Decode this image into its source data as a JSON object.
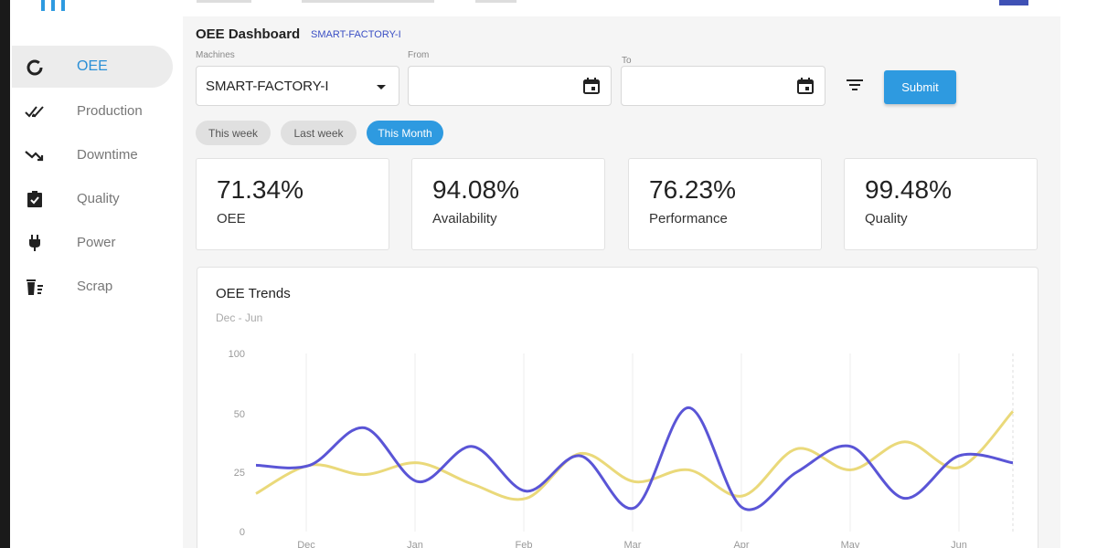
{
  "sidebar": {
    "items": [
      {
        "label": "OEE",
        "icon": "donut-chart-icon",
        "active": true
      },
      {
        "label": "Production",
        "icon": "double-check-icon",
        "active": false
      },
      {
        "label": "Downtime",
        "icon": "trending-down-icon",
        "active": false
      },
      {
        "label": "Quality",
        "icon": "clipboard-check-icon",
        "active": false
      },
      {
        "label": "Power",
        "icon": "plug-icon",
        "active": false
      },
      {
        "label": "Scrap",
        "icon": "trash-list-icon",
        "active": false
      }
    ]
  },
  "header": {
    "title": "OEE Dashboard",
    "machine_tag": "SMART-FACTORY-I"
  },
  "filters": {
    "machines_label": "Machines",
    "machines_value": "SMART-FACTORY-I",
    "from_label": "From",
    "from_value": "",
    "to_label": "To",
    "to_value": "",
    "submit_label": "Submit",
    "chips": [
      {
        "label": "This week",
        "active": false
      },
      {
        "label": "Last week",
        "active": false
      },
      {
        "label": "This Month",
        "active": true
      }
    ]
  },
  "kpis": [
    {
      "value": "71.34%",
      "label": "OEE"
    },
    {
      "value": "94.08%",
      "label": "Availability"
    },
    {
      "value": "76.23%",
      "label": "Performance"
    },
    {
      "value": "99.48%",
      "label": "Quality"
    }
  ],
  "colors": {
    "accent": "#2e9ae0",
    "series_purple": "#5a55d6",
    "series_yellow": "#ead97a"
  },
  "chart_data": {
    "type": "line",
    "title": "OEE Trends",
    "subtitle": "Dec - Jun",
    "ylim": [
      0,
      100
    ],
    "y_ticks": [
      "100",
      "50",
      "25",
      "0"
    ],
    "x_ticks": [
      "Dec",
      "Jan",
      "Feb",
      "Mar",
      "Apr",
      "May",
      "Jun"
    ],
    "x": [
      0,
      0.5,
      1,
      1.5,
      2,
      2.5,
      3,
      3.5,
      4,
      4.5,
      5,
      5.5,
      6,
      6.5
    ],
    "series": [
      {
        "color": "#5a55d6",
        "values": [
          28,
          28,
          44,
          21,
          36,
          17,
          32,
          10,
          55,
          10,
          25,
          36,
          14,
          32,
          29
        ]
      },
      {
        "color": "#ead97a",
        "values": [
          16,
          28,
          24,
          29,
          20,
          14,
          33,
          21,
          26,
          15,
          35,
          26,
          38,
          27,
          52
        ]
      }
    ],
    "grid": true
  }
}
